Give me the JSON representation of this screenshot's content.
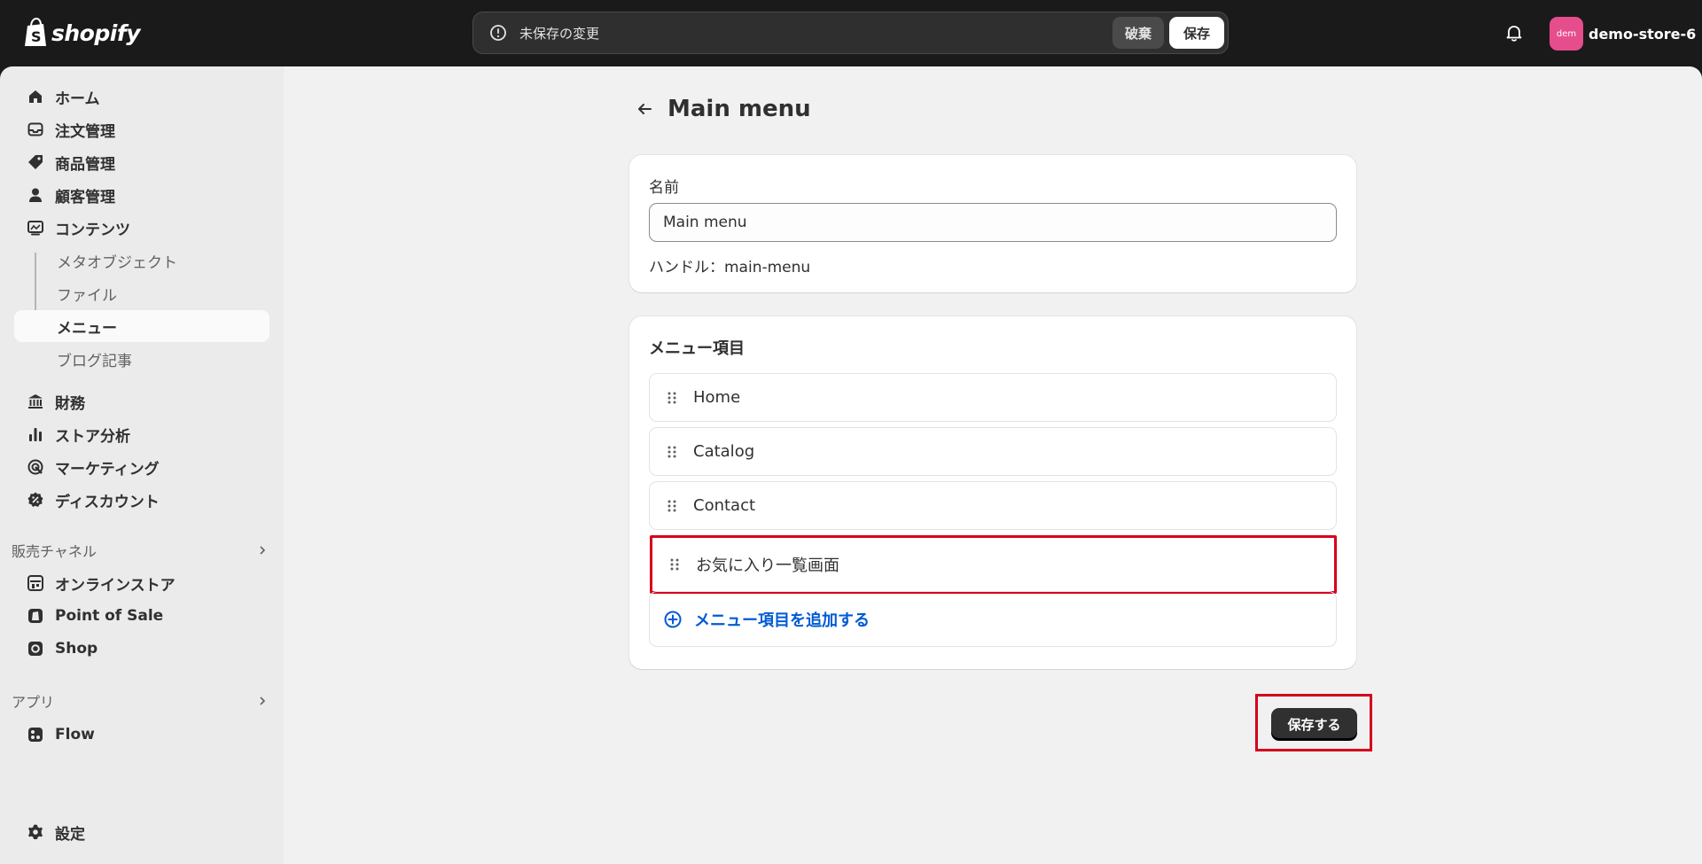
{
  "topbar": {
    "brand": "shopify",
    "savebar_text": "未保存の変更",
    "discard_label": "破棄",
    "save_label": "保存",
    "avatar_text": "dem",
    "store_name": "demo-store-6"
  },
  "sidebar": {
    "items": [
      {
        "label": "ホーム",
        "icon": "home-icon"
      },
      {
        "label": "注文管理",
        "icon": "inbox-icon"
      },
      {
        "label": "商品管理",
        "icon": "tag-icon"
      },
      {
        "label": "顧客管理",
        "icon": "person-icon"
      },
      {
        "label": "コンテンツ",
        "icon": "content-icon"
      }
    ],
    "content_sub": [
      "メタオブジェクト",
      "ファイル",
      "メニュー",
      "ブログ記事"
    ],
    "items2": [
      {
        "label": "財務",
        "icon": "bank-icon"
      },
      {
        "label": "ストア分析",
        "icon": "chart-icon"
      },
      {
        "label": "マーケティング",
        "icon": "target-icon"
      },
      {
        "label": "ディスカウント",
        "icon": "discount-icon"
      }
    ],
    "sales_channels_heading": "販売チャネル",
    "sales_channels": [
      "オンラインストア",
      "Point of Sale",
      "Shop"
    ],
    "apps_heading": "アプリ",
    "apps": [
      "Flow"
    ],
    "settings_label": "設定"
  },
  "page": {
    "title": "Main menu",
    "name_label": "名前",
    "name_value": "Main menu",
    "handle_text": "ハンドル：main-menu",
    "menu_items_title": "メニュー項目",
    "menu_items": [
      "Home",
      "Catalog",
      "Contact",
      "お気に入り一覧画面"
    ],
    "add_item_label": "メニュー項目を追加する",
    "save_button": "保存する"
  },
  "colors": {
    "highlight": "#d5001c",
    "link": "#005bd3",
    "avatar": "#e64d8c"
  }
}
